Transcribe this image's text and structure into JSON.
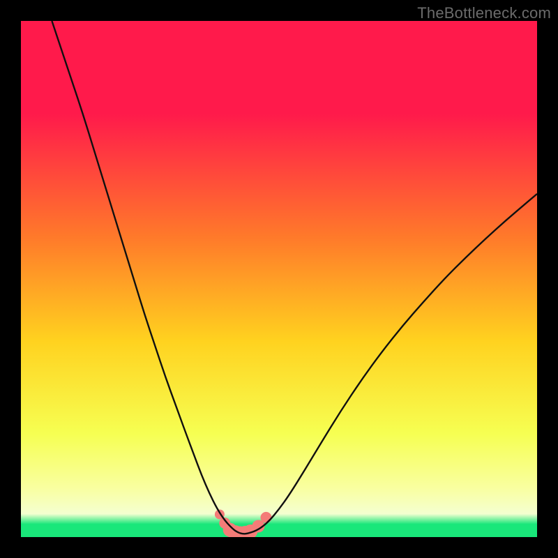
{
  "watermark": "TheBottleneck.com",
  "colors": {
    "bg_black": "#000000",
    "grad_top": "#ff1a4b",
    "grad_mid1": "#ff7a2a",
    "grad_mid2": "#ffd21f",
    "grad_mid3": "#f6ff52",
    "grad_bottom_yellow": "#f9ffa0",
    "grad_pale": "#f4ffd0",
    "grad_green": "#19e77a",
    "curve_stroke": "#101010",
    "marker_fill": "#f47c78",
    "marker_stroke": "#e46560"
  },
  "chart_data": {
    "type": "line",
    "title": "",
    "xlabel": "",
    "ylabel": "",
    "xlim": [
      0,
      100
    ],
    "ylim": [
      0,
      100
    ],
    "series": [
      {
        "name": "bottleneck-curve",
        "x": [
          6,
          8,
          10,
          12,
          14,
          16,
          18,
          20,
          22,
          24,
          26,
          28,
          30,
          32,
          33.5,
          35,
          36.5,
          38,
          39.5,
          41,
          42,
          43,
          44,
          46,
          48,
          50,
          52,
          55,
          58,
          62,
          66,
          70,
          74,
          78,
          82,
          86,
          90,
          94,
          98,
          100
        ],
        "y": [
          100,
          94,
          88,
          82,
          75.5,
          69,
          62.5,
          56,
          49.5,
          43,
          37,
          31,
          25.5,
          20,
          16,
          12,
          8.5,
          5.5,
          3.2,
          1.6,
          0.9,
          0.6,
          0.7,
          1.4,
          3.0,
          5.4,
          8.2,
          13.0,
          18.0,
          24.5,
          30.5,
          36.0,
          41.0,
          45.6,
          50.0,
          54.0,
          57.8,
          61.4,
          64.8,
          66.5
        ]
      }
    ],
    "markers": {
      "name": "highlight-band",
      "x": [
        38.5,
        39.5,
        40.5,
        41.5,
        42.5,
        43.5,
        44.5,
        46.0,
        47.5
      ],
      "y": [
        4.4,
        2.7,
        1.4,
        0.8,
        0.6,
        0.7,
        1.1,
        2.1,
        3.8
      ],
      "r": [
        7,
        8,
        10,
        11,
        11,
        11,
        10,
        9,
        8
      ]
    },
    "gradient_stops": [
      {
        "offset": 0.0,
        "key": "grad_top"
      },
      {
        "offset": 0.18,
        "key": "grad_top"
      },
      {
        "offset": 0.42,
        "key": "grad_mid1"
      },
      {
        "offset": 0.62,
        "key": "grad_mid2"
      },
      {
        "offset": 0.8,
        "key": "grad_mid3"
      },
      {
        "offset": 0.905,
        "key": "grad_bottom_yellow"
      },
      {
        "offset": 0.955,
        "key": "grad_pale"
      },
      {
        "offset": 0.975,
        "key": "grad_green"
      },
      {
        "offset": 1.0,
        "key": "grad_green"
      }
    ]
  }
}
